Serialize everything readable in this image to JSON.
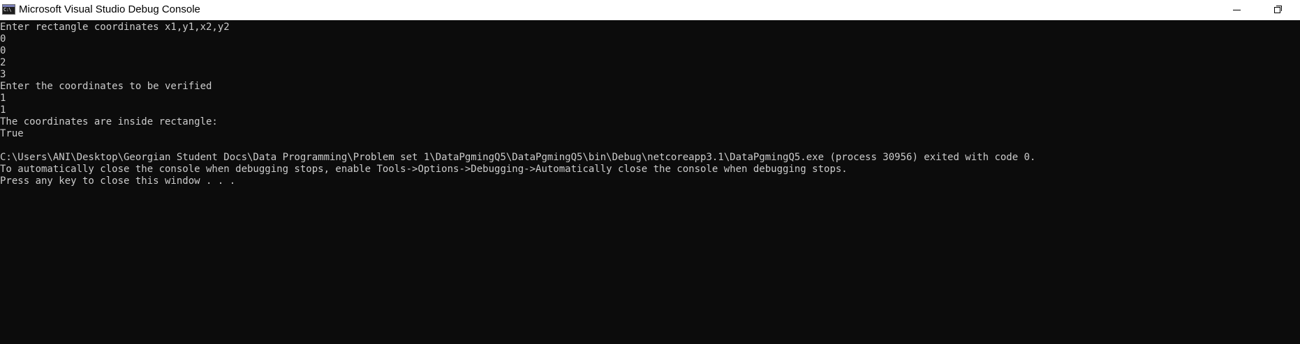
{
  "window": {
    "title": "Microsoft Visual Studio Debug Console",
    "icon": "console-app-icon",
    "icon_text": "C:\\"
  },
  "controls": {
    "minimize_icon": "minimize-icon",
    "restore_icon": "restore-icon"
  },
  "colors": {
    "console_background": "#0c0c0c",
    "console_text": "#cccccc",
    "titlebar_background": "#ffffff"
  },
  "console": {
    "lines": [
      "Enter rectangle coordinates x1,y1,x2,y2",
      "0",
      "0",
      "2",
      "3",
      "Enter the coordinates to be verified",
      "1",
      "1",
      "The coordinates are inside rectangle:",
      "True",
      "",
      "C:\\Users\\ANI\\Desktop\\Georgian Student Docs\\Data Programming\\Problem set 1\\DataPgmingQ5\\DataPgmingQ5\\bin\\Debug\\netcoreapp3.1\\DataPgmingQ5.exe (process 30956) exited with code 0.",
      "To automatically close the console when debugging stops, enable Tools->Options->Debugging->Automatically close the console when debugging stops.",
      "Press any key to close this window . . ."
    ]
  }
}
